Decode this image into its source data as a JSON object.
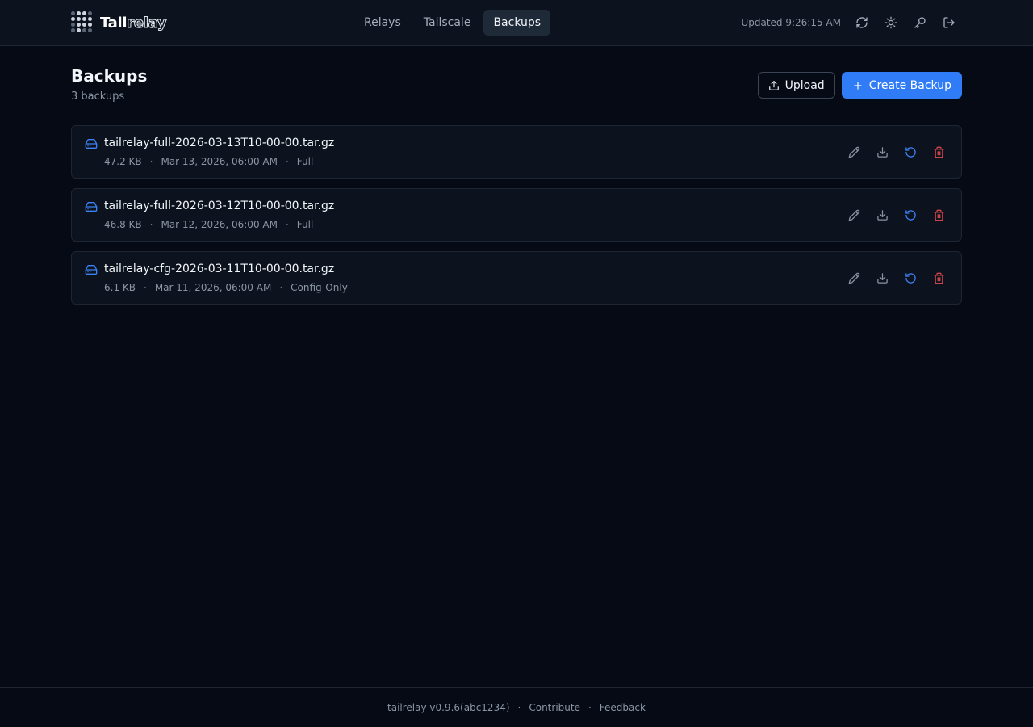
{
  "app": {
    "name_part1": "Tail",
    "name_part2": "relay"
  },
  "nav": {
    "tabs": [
      "Relays",
      "Tailscale",
      "Backups"
    ],
    "active": "Backups"
  },
  "header": {
    "updated": "Updated 9:26:15 AM"
  },
  "page": {
    "title": "Backups",
    "subtitle": "3 backups",
    "upload_label": "Upload",
    "create_label": "Create Backup"
  },
  "backups": [
    {
      "name": "tailrelay-full-2026-03-13T10-00-00.tar.gz",
      "size": "47.2 KB",
      "date": "Mar 13, 2026, 06:00 AM",
      "type": "Full"
    },
    {
      "name": "tailrelay-full-2026-03-12T10-00-00.tar.gz",
      "size": "46.8 KB",
      "date": "Mar 12, 2026, 06:00 AM",
      "type": "Full"
    },
    {
      "name": "tailrelay-cfg-2026-03-11T10-00-00.tar.gz",
      "size": "6.1 KB",
      "date": "Mar 11, 2026, 06:00 AM",
      "type": "Config-Only"
    }
  ],
  "footer": {
    "version": "tailrelay v0.9.6(abc1234)",
    "contribute": "Contribute",
    "feedback": "Feedback",
    "separator": "·"
  },
  "colors": {
    "accent": "#2f7cf6",
    "danger": "#e5484d",
    "background": "#050a14",
    "surface": "#0d131e"
  }
}
